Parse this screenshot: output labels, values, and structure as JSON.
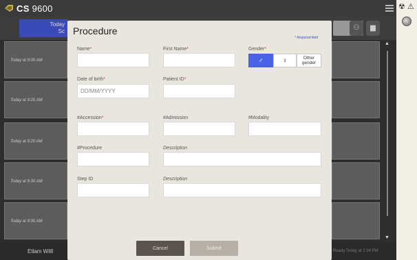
{
  "app": {
    "title": "CS",
    "title_num": "9600",
    "brand_color": "#3a4bb8"
  },
  "toolbar": {
    "filter_label_1": "Today",
    "filter_label_2": "Sc"
  },
  "list": {
    "items": [
      {
        "time": "Today at 9:00 AM"
      },
      {
        "time": "Today at 9:20 AM"
      },
      {
        "time": "Today at 9:20 AM"
      },
      {
        "time": "Today at 9:30 AM"
      },
      {
        "time": "Today at 9:30 AM"
      }
    ]
  },
  "status": {
    "user": "Etlam Willl",
    "ready": "Ready Today at 2:34 PM"
  },
  "dialog": {
    "title": "Procedure",
    "required_note": "* Required field",
    "fields": {
      "name": {
        "label": "Name",
        "value": ""
      },
      "first_name": {
        "label": "First Name",
        "value": ""
      },
      "gender": {
        "label": "Gender"
      },
      "dob": {
        "label": "Date of birth",
        "placeholder": "DD/MM/YYYY"
      },
      "patient_id": {
        "label": "Patient ID",
        "value": ""
      },
      "accession": {
        "label": "#Accession",
        "value": ""
      },
      "admission": {
        "label": "#Admission",
        "value": ""
      },
      "modality": {
        "label": "#Modality",
        "value": ""
      },
      "procedure": {
        "label": "#Procedure",
        "value": ""
      },
      "description1": {
        "label": "Description",
        "value": ""
      },
      "step_id": {
        "label": "Step ID",
        "value": ""
      },
      "description2": {
        "label": "Description",
        "value": ""
      }
    },
    "gender_options": {
      "male": "♂",
      "female": "♀",
      "other_line1": "Other",
      "other_line2": "gender",
      "selected": "male"
    },
    "required_marker": "*",
    "cancel_label": "Cancel",
    "submit_label": "Submit",
    "accent_color": "#4a62e6"
  }
}
